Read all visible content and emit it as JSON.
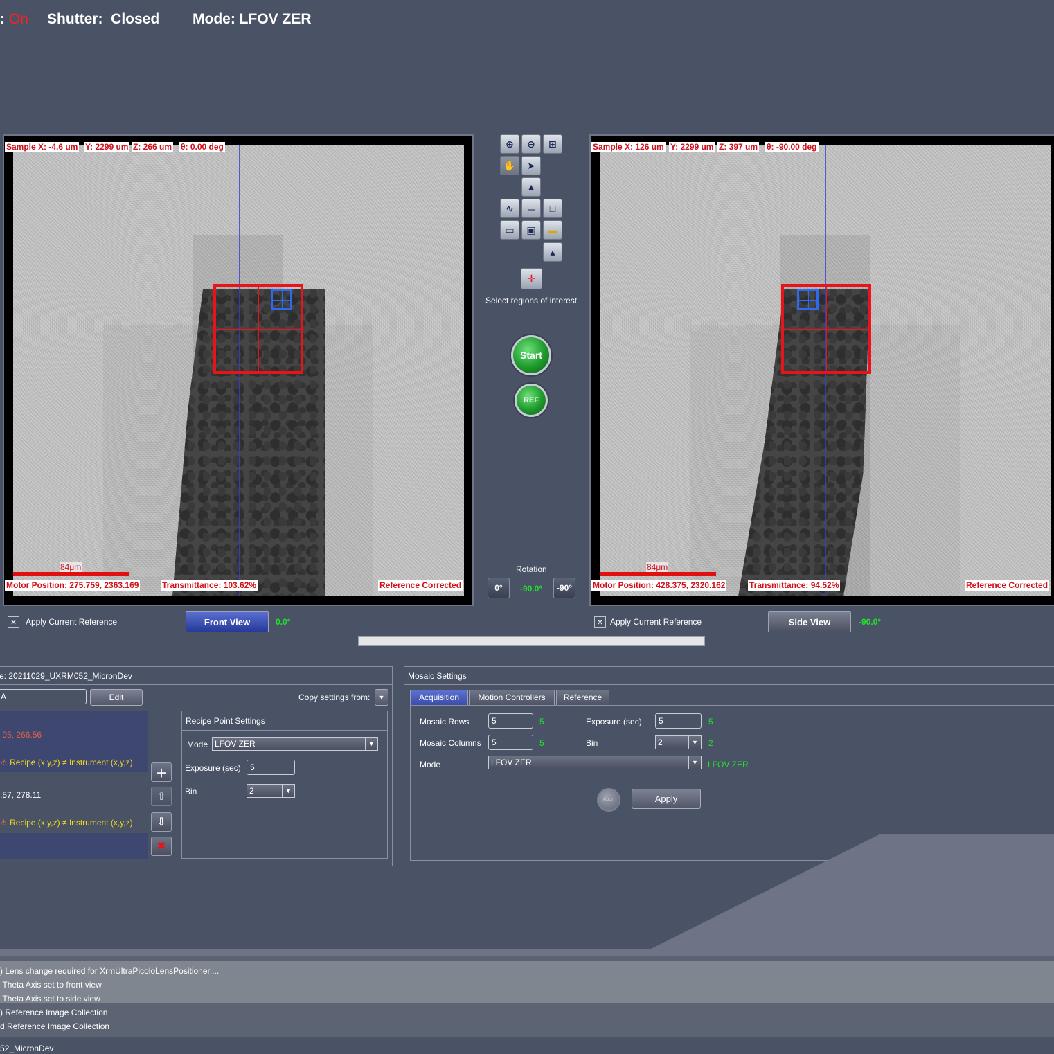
{
  "status_bar": {
    "prefix": ":",
    "source_value": "On",
    "shutter_label": "Shutter:",
    "shutter_value": "Closed",
    "mode_label": "Mode:",
    "mode_value": "LFOV ZER"
  },
  "front_view": {
    "sample_x": "Sample X:  -4.6 um",
    "sample_y": "Y: 2299 um",
    "sample_z": "Z:  266 um",
    "theta": "θ: 0.00 deg",
    "scale": "84μm",
    "motor_position": "Motor Position: 275.759, 2363.169",
    "transmittance": "Transmittance: 103.62%",
    "reference": "Reference Corrected",
    "apply_reference": "Apply Current Reference",
    "button": "Front View",
    "angle": "0.0°"
  },
  "side_view": {
    "sample_x": "Sample X:  126 um",
    "sample_y": "Y: 2299 um",
    "sample_z": "Z:  397 um",
    "theta": "θ: -90.00 deg",
    "scale": "84μm",
    "motor_position": "Motor Position: 428.375, 2320.162",
    "transmittance": "Transmittance: 94.52%",
    "reference": "Reference Corrected",
    "apply_reference": "Apply Current Reference",
    "button": "Side View",
    "angle": "-90.0°"
  },
  "center_controls": {
    "roi_label": "Select regions of interest",
    "start_label": "Start",
    "ref_label": "REF",
    "rotation_label": "Rotation",
    "rot_zero": "0°",
    "rot_value": "-90.0°",
    "rot_minus90": "-90°",
    "icons": [
      "zoom-in-icon",
      "zoom-out-icon",
      "zoom-fit-icon",
      "pan-hand-icon",
      "pointer-icon",
      "histogram-icon",
      "line-profile-icon",
      "ruler-icon",
      "frame-icon",
      "save-icon",
      "export-image-icon",
      "open-folder-icon",
      "stage-icon",
      "crosshair-icon"
    ]
  },
  "recipe_panel": {
    "title": "e: 20211029_UXRM052_MicronDev",
    "name_value": "A",
    "edit_label": "Edit",
    "copy_label": "Copy settings from:",
    "items": [
      {
        "coords": ".95, 266.56",
        "warning": "Recipe (x,y,z) ≠ Instrument (x,y,z)"
      },
      {
        "coords": ".57, 278.11",
        "warning": "Recipe (x,y,z) ≠ Instrument (x,y,z)"
      }
    ],
    "point_settings_title": "Recipe Point Settings",
    "mode_label": "Mode",
    "mode_value": "LFOV ZER",
    "exposure_label": "Exposure (sec)",
    "exposure_value": "5",
    "bin_label": "Bin",
    "bin_value": "2"
  },
  "mosaic_panel": {
    "title": "Mosaic Settings",
    "tabs": [
      "Acquisition",
      "Motion Controllers",
      "Reference"
    ],
    "rows_label": "Mosaic Rows",
    "rows_value": "5",
    "rows_current": "5",
    "cols_label": "Mosaic Columns",
    "cols_value": "5",
    "cols_current": "5",
    "exposure_label": "Exposure (sec)",
    "exposure_value": "5",
    "exposure_current": "5",
    "bin_label": "Bin",
    "bin_value": "2",
    "bin_current": "2",
    "mode_label": "Mode",
    "mode_value": "LFOV ZER",
    "mode_current": "LFOV ZER",
    "abort_label": "Abort",
    "apply_label": "Apply"
  },
  "log": [
    "Lens change required for XrmUltraPicoloLensPositioner....",
    "Theta Axis set to front view",
    "Theta Axis set to side view",
    "Reference Image Collection",
    "Reference Image Collection"
  ],
  "footer": "52_MicronDev",
  "colors": {
    "background": "#4a5266",
    "roi_red": "#e8141a",
    "roi_blue": "#2c6bf0",
    "status_green": "#22e02a",
    "warning_yellow": "#f2d81c"
  }
}
